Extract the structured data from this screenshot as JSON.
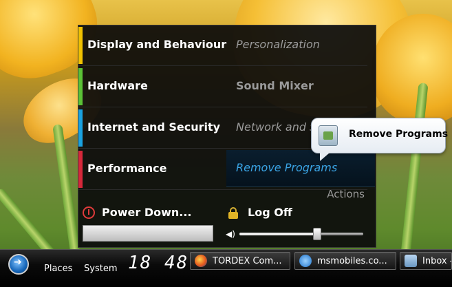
{
  "menu": {
    "categories": [
      {
        "label": "Display and Behaviour",
        "item": "Personalization",
        "accent": "#f2c200"
      },
      {
        "label": "Hardware",
        "item": "Sound Mixer",
        "accent": "#5bc236"
      },
      {
        "label": "Internet and Security",
        "item": "Network and Sharing",
        "accent": "#1aa2e0"
      },
      {
        "label": "Performance",
        "item": "Remove Programs",
        "accent": "#d6283a"
      }
    ],
    "actions_label": "Actions",
    "power_label": "Power Down...",
    "logoff_label": "Log Off",
    "volume_level": 0.63
  },
  "tooltip": {
    "text": "Remove Programs"
  },
  "taskbar": {
    "places_label": "Places",
    "system_label": "System",
    "clock": "18 48",
    "tasks": [
      {
        "label": "TORDEX Com...",
        "icon": "firefox-icon"
      },
      {
        "label": "msmobiles.co...",
        "icon": "internet-explorer-icon"
      },
      {
        "label": "Inbox -",
        "icon": "mail-inbox-icon"
      }
    ]
  }
}
